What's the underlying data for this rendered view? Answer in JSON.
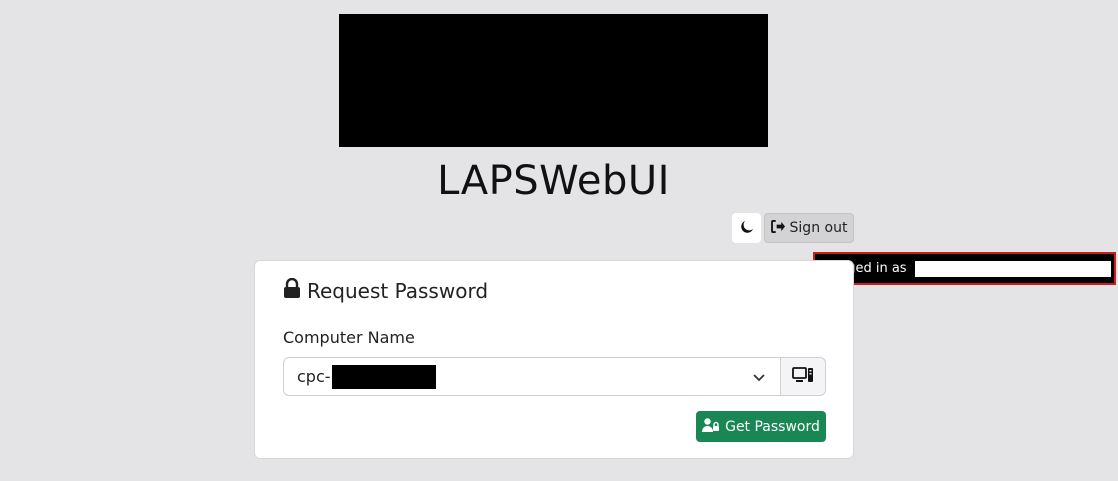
{
  "app": {
    "title": "LAPSWebUI"
  },
  "header": {
    "theme_toggle_icon": "moon-icon",
    "signout_label": "Sign out",
    "signout_icon": "sign-out-icon"
  },
  "login_badge": {
    "prefix": "Logged in as"
  },
  "card": {
    "title": "Request Password",
    "title_icon": "lock-icon",
    "computer_label": "Computer Name",
    "computer_value_prefix": "cpc-",
    "addon_icon": "computer-icon",
    "get_password_label": "Get Password",
    "get_password_icon": "user-lock-icon"
  },
  "colors": {
    "background": "#e4e3e6",
    "primary_success": "#198754",
    "badge_border": "#d11a1a"
  }
}
